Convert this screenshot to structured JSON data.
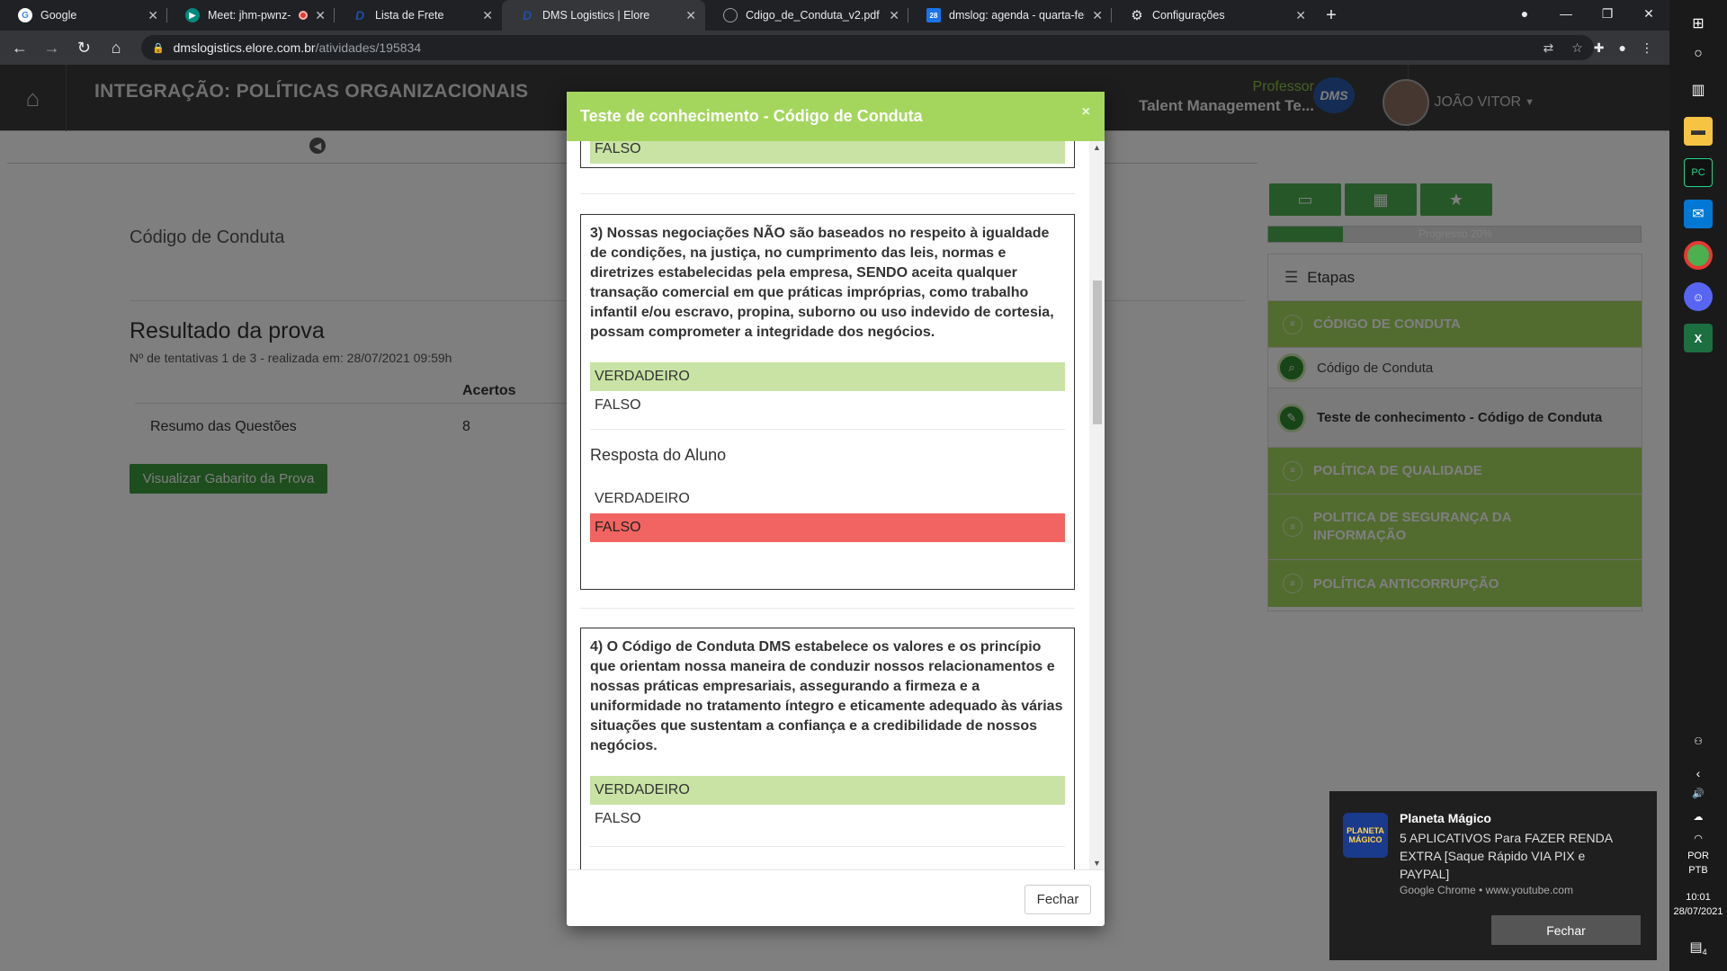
{
  "browser": {
    "tabs": [
      {
        "label": "Google",
        "icon": "google-icon",
        "color": "#ffffff",
        "active": false
      },
      {
        "label": "Meet: jhm-pwnz-kca",
        "icon": "meet-icon",
        "color": "#00897b",
        "active": false
      },
      {
        "label": "",
        "icon": "recording-icon",
        "color": "#e53935",
        "active": false
      },
      {
        "label": "Lista de Frete",
        "icon": "d-logo-icon",
        "color": "#1e4fa8",
        "active": false
      },
      {
        "label": "DMS Logistics | Elore",
        "icon": "d-logo-icon",
        "color": "#1e4fa8",
        "active": true
      },
      {
        "label": "Cdigo_de_Conduta_v2.pdf",
        "icon": "globe-icon",
        "color": "#9aa0a6",
        "active": false
      },
      {
        "label": "dmslog: agenda - quarta-feira,",
        "icon": "calendar-icon",
        "color": "#1a73e8",
        "active": false
      },
      {
        "label": "Configurações",
        "icon": "gear-icon",
        "color": "#e8eaed",
        "active": false
      }
    ],
    "url_host": "dmslogistics.elore.com.br",
    "url_path": "/atividades/195834"
  },
  "header": {
    "title": "INTEGRAÇÃO: POLÍTICAS ORGANIZACIONAIS",
    "role": "Professor",
    "org": "Talent Management Te...",
    "logo_text": "DMS",
    "user": "JOÃO VITOR"
  },
  "content": {
    "section_title": "Código de Conduta",
    "result_title": "Resultado da prova",
    "result_sub": "Nº de tentativas 1 de 3 - realizada em: 28/07/2021 09:59h",
    "col_header": "Acertos",
    "row_label": "Resumo das Questões",
    "row_value": "8",
    "gabarito_button": "Visualizar Gabarito da Prova"
  },
  "progress": {
    "label": "Progresso 20%",
    "value": 0.2
  },
  "etapas": {
    "title": "Etapas",
    "steps": [
      {
        "label": "CÓDIGO DE CONDUTA",
        "type": "section"
      },
      {
        "label": "Código de Conduta",
        "type": "item"
      },
      {
        "label": "Teste de conhecimento - Código de Conduta",
        "type": "item-current"
      },
      {
        "label": "POLÍTICA DE QUALIDADE",
        "type": "section"
      },
      {
        "label": "POLITICA DE SEGURANÇA DA INFORMAÇÃO",
        "type": "section"
      },
      {
        "label": "POLÍTICA ANTICORRUPÇÃO",
        "type": "section"
      }
    ]
  },
  "modal": {
    "title": "Teste de conhecimento - Código de Conduta",
    "close_glyph": "×",
    "prev_option": "FALSO",
    "q3": {
      "text": "3) Nossas negociações NÃO são baseados no respeito à igualdade de condições, na justiça, no cumprimento das leis, normas e diretrizes estabelecidas pela empresa, SENDO aceita qualquer transação comercial em que práticas impróprias, como trabalho infantil e/ou escravo, propina, suborno ou uso indevido de cortesia, possam comprometer a integridade dos negócios.",
      "options": [
        "VERDADEIRO",
        "FALSO"
      ],
      "correct": "VERDADEIRO",
      "resp_label": "Resposta do Aluno",
      "student_options": [
        "VERDADEIRO",
        "FALSO"
      ],
      "student_answer": "FALSO"
    },
    "q4": {
      "text": "4) O Código de Conduta DMS estabelece os valores e os princípio que orientam nossa maneira de conduzir nossos relacionamentos e nossas práticas empresariais, assegurando a firmeza e a uniformidade no tratamento íntegro e eticamente adequado às várias situações que sustentam a confiança e a credibilidade de nossos negócios.",
      "options": [
        "VERDADEIRO",
        "FALSO"
      ],
      "correct": "VERDADEIRO"
    },
    "close_button": "Fechar"
  },
  "toast": {
    "app_title": "Planeta Mágico",
    "icon_text": "PLANETA MÁGICO",
    "message": "5 APLICATIVOS Para FAZER RENDA EXTRA [Saque Rápido VIA PIX e PAYPAL]",
    "source": "Google Chrome • www.youtube.com",
    "button": "Fechar"
  },
  "taskbar": {
    "lang1": "POR",
    "lang2": "PTB",
    "time": "10:01",
    "date": "28/07/2021",
    "notif_count": "4"
  },
  "colors": {
    "accent_green": "#a4d65e",
    "button_green": "#3c9a3c",
    "wrong_red": "#f26461",
    "correct_green": "#c8e3a4"
  }
}
